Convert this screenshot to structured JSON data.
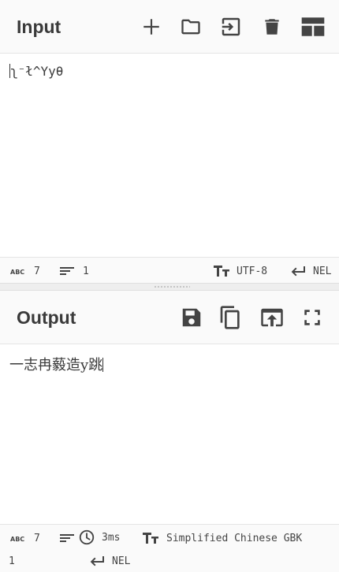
{
  "input": {
    "title": "Input",
    "text": "ʅ⁻ł^Yyθ",
    "buttons": [
      "add-icon",
      "open-folder-icon",
      "import-icon",
      "trash-icon",
      "layout-icon"
    ],
    "status": {
      "length": "7",
      "lines": "1",
      "encoding": "UTF-8",
      "eol": "NEL"
    }
  },
  "output": {
    "title": "Output",
    "text": "一志冉藙造y跳",
    "buttons": [
      "save-icon",
      "copy-icon",
      "replace-input-icon",
      "fullscreen-icon"
    ],
    "status": {
      "length": "7",
      "lines": "1",
      "time": "3ms",
      "encoding": "Simplified Chinese GBK",
      "eol": "NEL"
    }
  }
}
